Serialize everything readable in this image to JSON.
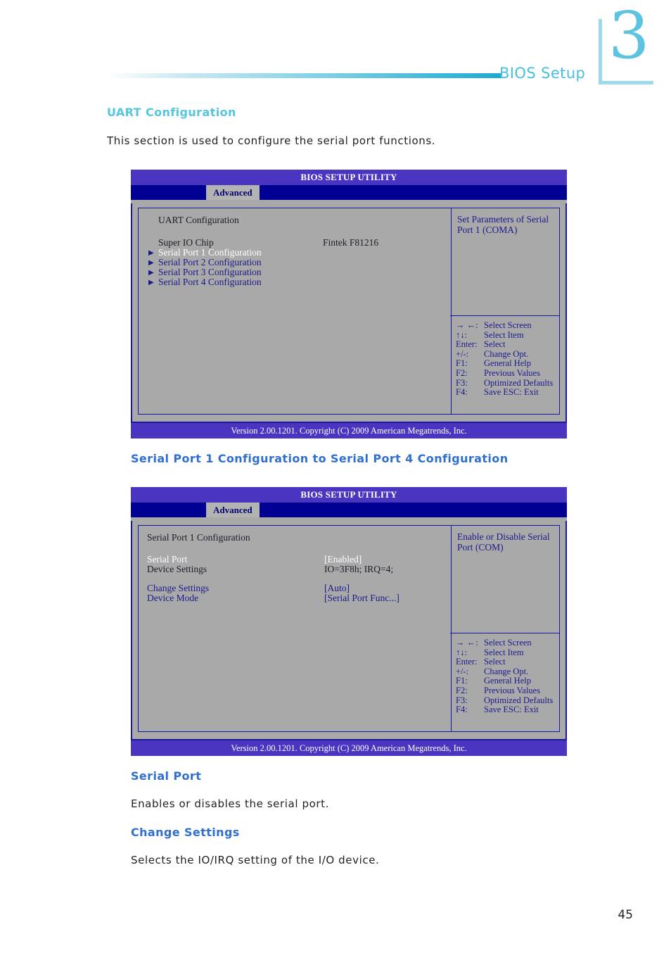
{
  "header": {
    "title": "BIOS Setup",
    "chapter": "3"
  },
  "page": {
    "number": "45"
  },
  "sections": {
    "uart_heading": "UART Configuration",
    "uart_intro": "This section is used to configure the serial port functions.",
    "serial_range_heading": "Serial Port 1 Configuration to Serial Port 4 Configuration",
    "serial_port_heading": "Serial Port",
    "serial_port_body": "Enables or disables the serial port.",
    "change_settings_heading": "Change Settings",
    "change_settings_body": "Selects the IO/IRQ setting of the I/O device."
  },
  "bios_screen_1": {
    "title": "BIOS SETUP UTILITY",
    "tab": "Advanced",
    "section_title": "UART Configuration",
    "items": [
      {
        "label": "Super IO Chip",
        "value": "Fintek F81216",
        "style": "dark",
        "arrow": false
      },
      {
        "label": "Serial Port 1 Configuration",
        "value": "",
        "style": "white",
        "arrow": true
      },
      {
        "label": "Serial Port 2 Configuration",
        "value": "",
        "style": "blue",
        "arrow": true
      },
      {
        "label": "Serial Port 3 Configuration",
        "value": "",
        "style": "blue",
        "arrow": true
      },
      {
        "label": "Serial Port 4 Configuration",
        "value": "",
        "style": "blue",
        "arrow": true
      }
    ],
    "help_text": "Set Parameters of Serial Port 1 (COMA)",
    "keys": [
      {
        "key": "→ ←:",
        "action": "Select Screen"
      },
      {
        "key": "↑↓:",
        "action": "Select Item"
      },
      {
        "key": "Enter:",
        "action": "Select"
      },
      {
        "key": "+/-:",
        "action": "Change Opt."
      },
      {
        "key": "F1:",
        "action": "General Help"
      },
      {
        "key": "F2:",
        "action": "Previous Values"
      },
      {
        "key": "F3:",
        "action": "Optimized Defaults"
      },
      {
        "key": "F4:",
        "action": "Save   ESC: Exit"
      }
    ],
    "footer": "Version 2.00.1201. Copyright (C) 2009 American Megatrends, Inc."
  },
  "bios_screen_2": {
    "title": "BIOS SETUP UTILITY",
    "tab": "Advanced",
    "section_title": "Serial Port 1 Configuration",
    "items": [
      {
        "label": "Serial Port",
        "value": "[Enabled]",
        "style": "white"
      },
      {
        "label": "Device Settings",
        "value": "IO=3F8h; IRQ=4;",
        "style": "dark"
      },
      {
        "label": "Change Settings",
        "value": "[Auto]",
        "style": "blue"
      },
      {
        "label": "Device Mode",
        "value": "[Serial Port Func...]",
        "style": "blue"
      }
    ],
    "help_text": "Enable or Disable Serial Port (COM)",
    "keys": [
      {
        "key": "→ ←:",
        "action": "Select Screen"
      },
      {
        "key": "↑↓:",
        "action": "Select Item"
      },
      {
        "key": "Enter:",
        "action": "Select"
      },
      {
        "key": "+/-:",
        "action": "Change Opt."
      },
      {
        "key": "F1:",
        "action": "General Help"
      },
      {
        "key": "F2:",
        "action": "Previous Values"
      },
      {
        "key": "F3:",
        "action": "Optimized Defaults"
      },
      {
        "key": "F4:",
        "action": "Save   ESC: Exit"
      }
    ],
    "footer": "Version 2.00.1201. Copyright (C) 2009 American Megatrends, Inc."
  }
}
